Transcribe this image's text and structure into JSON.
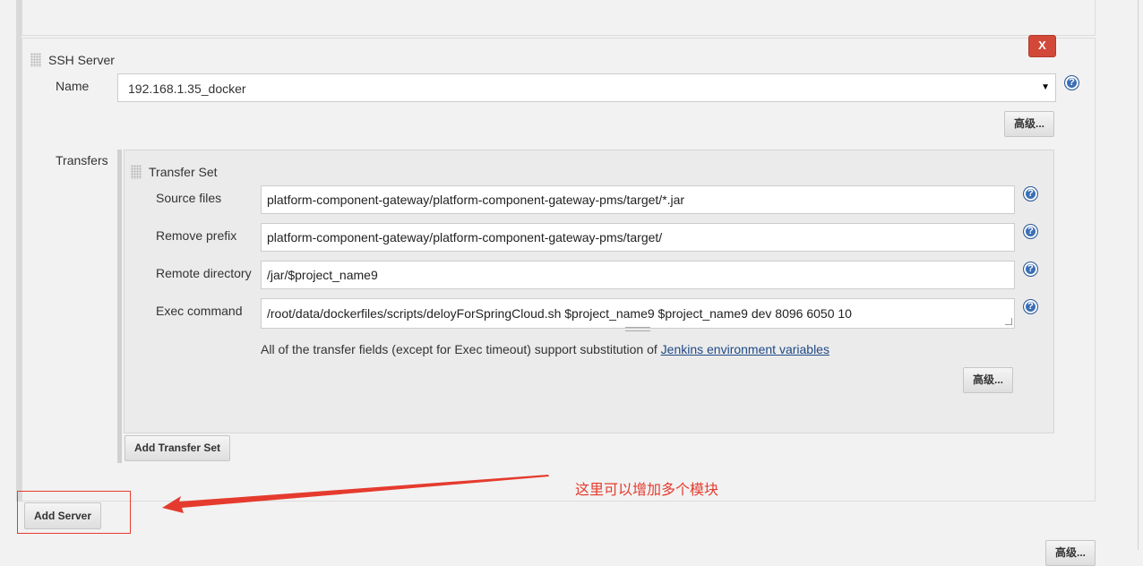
{
  "ssh_server": {
    "title": "SSH Server",
    "delete_label": "X",
    "name_label": "Name",
    "name_value": "192.168.1.35_docker",
    "advanced_label": "高级..."
  },
  "transfers": {
    "label": "Transfers",
    "set_title": "Transfer Set",
    "fields": {
      "source_files": {
        "label": "Source files",
        "value": "platform-component-gateway/platform-component-gateway-pms/target/*.jar"
      },
      "remove_prefix": {
        "label": "Remove prefix",
        "value": "platform-component-gateway/platform-component-gateway-pms/target/"
      },
      "remote_directory": {
        "label": "Remote directory",
        "value": "/jar/$project_name9"
      },
      "exec_command": {
        "label": "Exec command",
        "value": "/root/data/dockerfiles/scripts/deloyForSpringCloud.sh $project_name9 $project_name9 dev 8096 6050 10"
      }
    },
    "note_text": "All of the transfer fields (except for Exec timeout) support substitution of ",
    "note_link": "Jenkins environment variables",
    "advanced_label": "高级...",
    "add_transfer_set_label": "Add Transfer Set"
  },
  "add_server_label": "Add Server",
  "bottom_advanced_label": "高级...",
  "annotation": {
    "text": "这里可以增加多个模块",
    "color": "#e53b2e"
  },
  "help_icon_glyph": "?"
}
